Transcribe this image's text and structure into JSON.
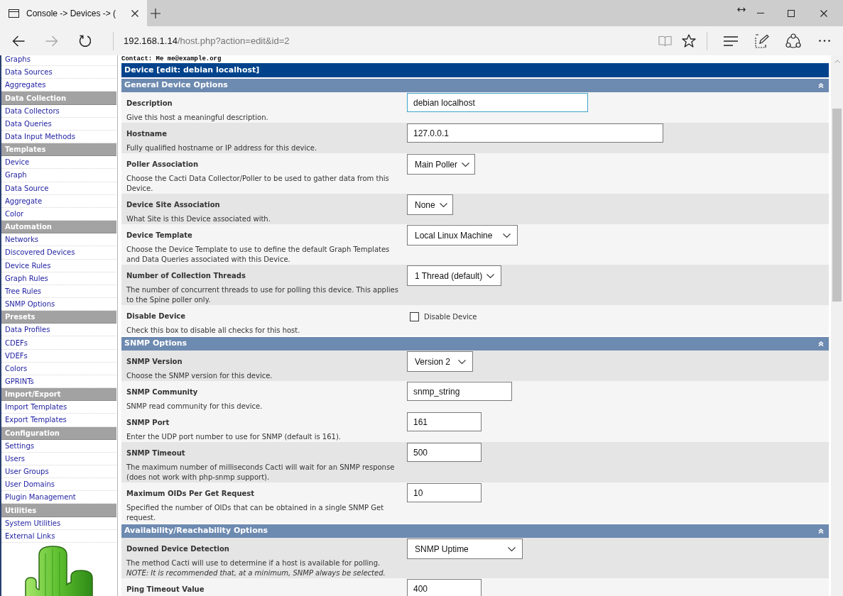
{
  "browser": {
    "tab": {
      "title": "Console -> Devices -> ("
    },
    "address": {
      "host": "192.168.1.14",
      "path": "/host.php?action=edit&id=2"
    }
  },
  "sidebar": {
    "groups": [
      {
        "items": [
          "Graphs",
          "Data Sources",
          "Aggregates"
        ]
      },
      {
        "header": "Data Collection",
        "items": [
          "Data Collectors",
          "Data Queries",
          "Data Input Methods"
        ]
      },
      {
        "header": "Templates",
        "items": [
          "Device",
          "Graph",
          "Data Source",
          "Aggregate",
          "Color"
        ]
      },
      {
        "header": "Automation",
        "items": [
          "Networks",
          "Discovered Devices",
          "Device Rules",
          "Graph Rules",
          "Tree Rules",
          "SNMP Options"
        ]
      },
      {
        "header": "Presets",
        "items": [
          "Data Profiles",
          "CDEFs",
          "VDEFs",
          "Colors",
          "GPRINTs"
        ]
      },
      {
        "header": "Import/Export",
        "items": [
          "Import Templates",
          "Export Templates"
        ]
      },
      {
        "header": "Configuration",
        "items": [
          "Settings",
          "Users",
          "User Groups",
          "User Domains",
          "Plugin Management"
        ]
      },
      {
        "header": "Utilities",
        "items": [
          "System Utilities",
          "External Links"
        ]
      }
    ]
  },
  "contact": "Contact: Me me@example.org",
  "panel": {
    "title": "Device [edit: debian localhost]",
    "sections": [
      {
        "title": "General Device Options",
        "rows": [
          {
            "kind": "text",
            "label": "Description",
            "description": "Give this host a meaningful description.",
            "value": "debian localhost",
            "focused": true,
            "shaded": false
          },
          {
            "kind": "text",
            "label": "Hostname",
            "description": "Fully qualified hostname or IP address for this device.",
            "value": "127.0.0.1",
            "focused": false,
            "shaded": true
          },
          {
            "kind": "select",
            "label": "Poller Association",
            "description": "Choose the Cacti Data Collector/Poller to be used to gather data from this Device.",
            "value": "Main Poller",
            "focused": false,
            "shaded": false
          },
          {
            "kind": "select",
            "label": "Device Site Association",
            "description": "What Site is this Device associated with.",
            "value": "None",
            "focused": false,
            "shaded": true
          },
          {
            "kind": "select",
            "label": "Device Template",
            "description": "Choose the Device Template to use to define the default Graph Templates and Data Queries associated with this Device.",
            "value": "Local Linux Machine",
            "focused": false,
            "shaded": false
          },
          {
            "kind": "select",
            "label": "Number of Collection Threads",
            "description": "The number of concurrent threads to use for polling this device. This applies to the Spine poller only.",
            "value": "1 Thread (default)",
            "focused": false,
            "shaded": true
          },
          {
            "kind": "checkbox",
            "label": "Disable Device",
            "description": "Check this box to disable all checks for this host.",
            "option": "Disable Device",
            "checked": false,
            "focused": false,
            "shaded": false
          }
        ]
      },
      {
        "title": "SNMP Options",
        "rows": [
          {
            "kind": "select",
            "label": "SNMP Version",
            "description": "Choose the SNMP version for this device.",
            "value": "Version 2",
            "focused": false,
            "shaded": true
          },
          {
            "kind": "text",
            "label": "SNMP Community",
            "description": "SNMP read community for this device.",
            "value": "snmp_string",
            "focused": false,
            "shaded": false
          },
          {
            "kind": "text",
            "label": "SNMP Port",
            "description": "Enter the UDP port number to use for SNMP (default is 161).",
            "value": "161",
            "focused": false,
            "shaded": false
          },
          {
            "kind": "text",
            "label": "SNMP Timeout",
            "description": "The maximum number of milliseconds Cacti will wait for an SNMP response (does not work with php-snmp support).",
            "value": "500",
            "focused": false,
            "shaded": true
          },
          {
            "kind": "text",
            "label": "Maximum OIDs Per Get Request",
            "description": "Specified the number of OIDs that can be obtained in a single SNMP Get request.",
            "value": "10",
            "focused": false,
            "shaded": false
          }
        ]
      },
      {
        "title": "Availability/Reachability Options",
        "rows": [
          {
            "kind": "select",
            "label": "Downed Device Detection",
            "description": "The method Cacti will use to determine if a host is available for polling.\n*NOTE: It is recommended that, at a minimum, SNMP always be selected.*",
            "value": "SNMP Uptime",
            "focused": false,
            "shaded": true
          },
          {
            "kind": "text",
            "label": "Ping Timeout Value",
            "value": "400",
            "focused": false,
            "shaded": false
          }
        ]
      }
    ]
  }
}
